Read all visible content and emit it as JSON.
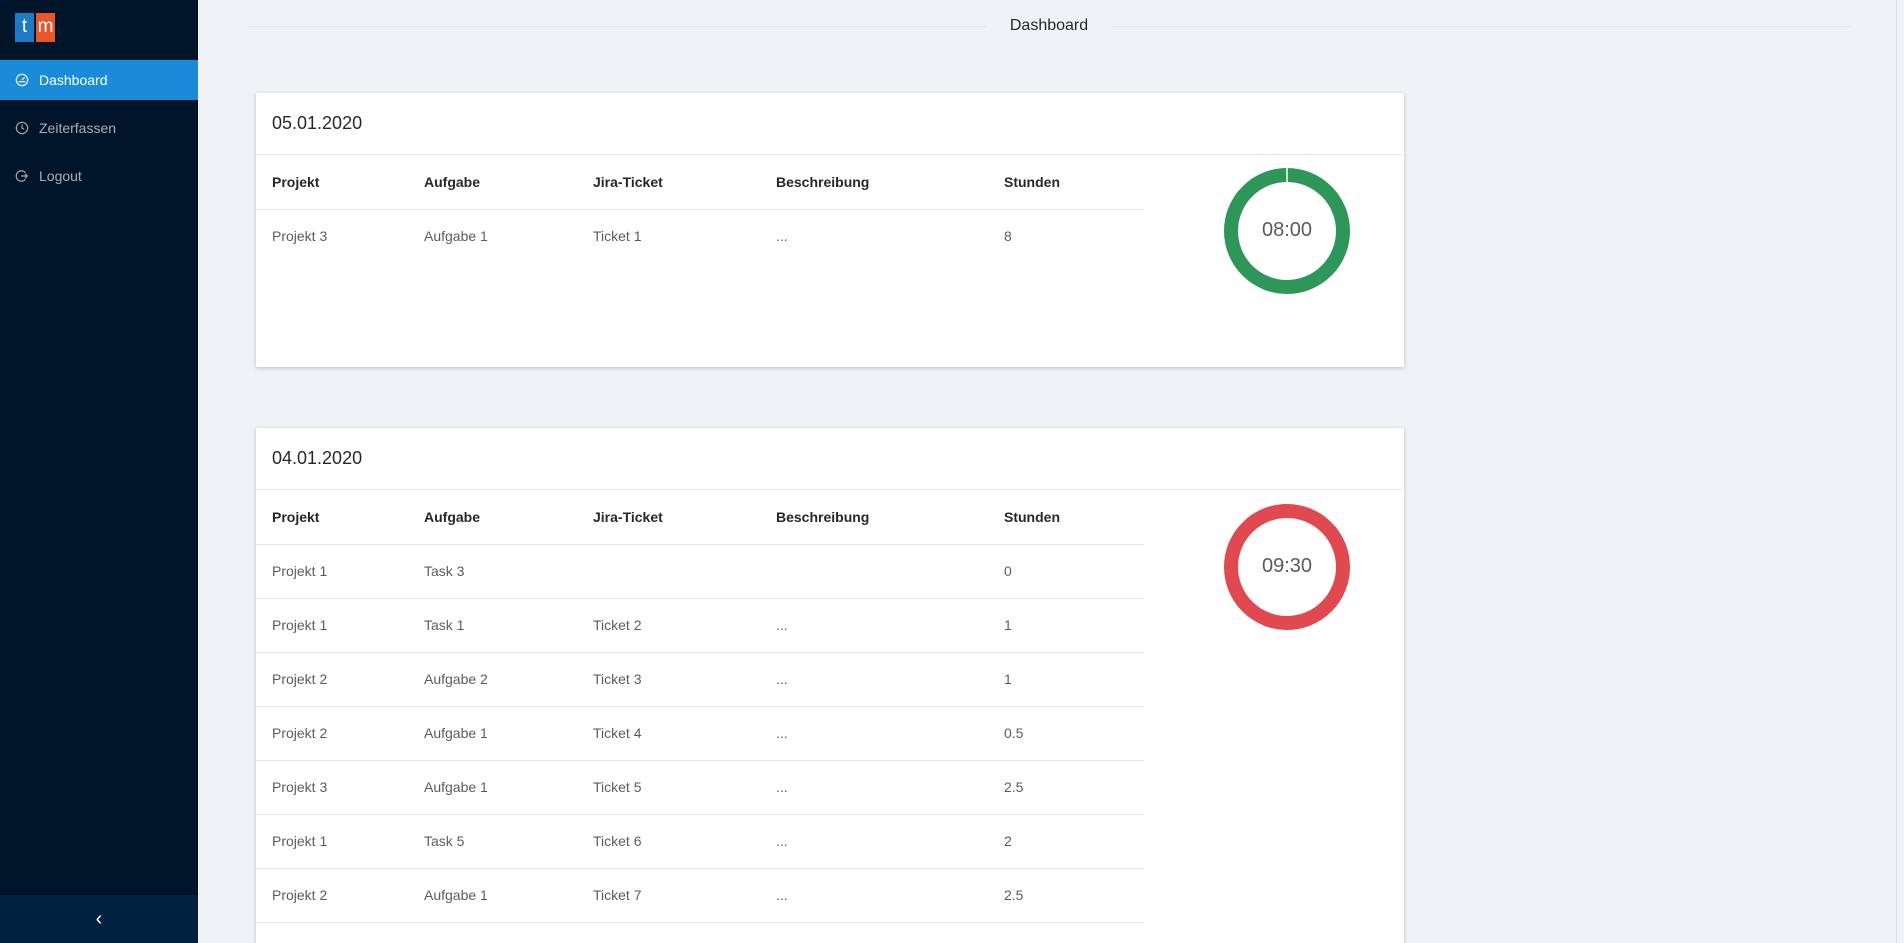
{
  "app": {
    "logo_letters": [
      "t",
      "m"
    ]
  },
  "sidebar": {
    "items": [
      {
        "label": "Dashboard",
        "icon": "dashboard-icon",
        "active": true
      },
      {
        "label": "Zeiterfassen",
        "icon": "clock-icon",
        "active": false
      },
      {
        "label": "Logout",
        "icon": "logout-icon",
        "active": false
      }
    ],
    "collapse_icon": "chevron-left-icon",
    "collapse_glyph": "‹"
  },
  "header": {
    "title": "Dashboard"
  },
  "columns": [
    "Projekt",
    "Aufgabe",
    "Jira-Ticket",
    "Beschreibung",
    "Stunden"
  ],
  "cards": [
    {
      "date": "05.01.2020",
      "total": "08:00",
      "status_color": "#2e9659",
      "rows": [
        [
          "Projekt 3",
          "Aufgabe 1",
          "Ticket 1",
          "...",
          "8"
        ]
      ]
    },
    {
      "date": "04.01.2020",
      "total": "09:30",
      "status_color": "#e0494f",
      "rows": [
        [
          "Projekt 1",
          "Task 3",
          "",
          "",
          "0"
        ],
        [
          "Projekt 1",
          "Task 1",
          "Ticket 2",
          "...",
          "1"
        ],
        [
          "Projekt 2",
          "Aufgabe 2",
          "Ticket 3",
          "...",
          "1"
        ],
        [
          "Projekt 2",
          "Aufgabe 1",
          "Ticket 4",
          "...",
          "0.5"
        ],
        [
          "Projekt 3",
          "Aufgabe 1",
          "Ticket 5",
          "...",
          "2.5"
        ],
        [
          "Projekt 1",
          "Task 5",
          "Ticket 6",
          "...",
          "2"
        ],
        [
          "Projekt 2",
          "Aufgabe 1",
          "Ticket 7",
          "...",
          "2.5"
        ]
      ]
    }
  ]
}
